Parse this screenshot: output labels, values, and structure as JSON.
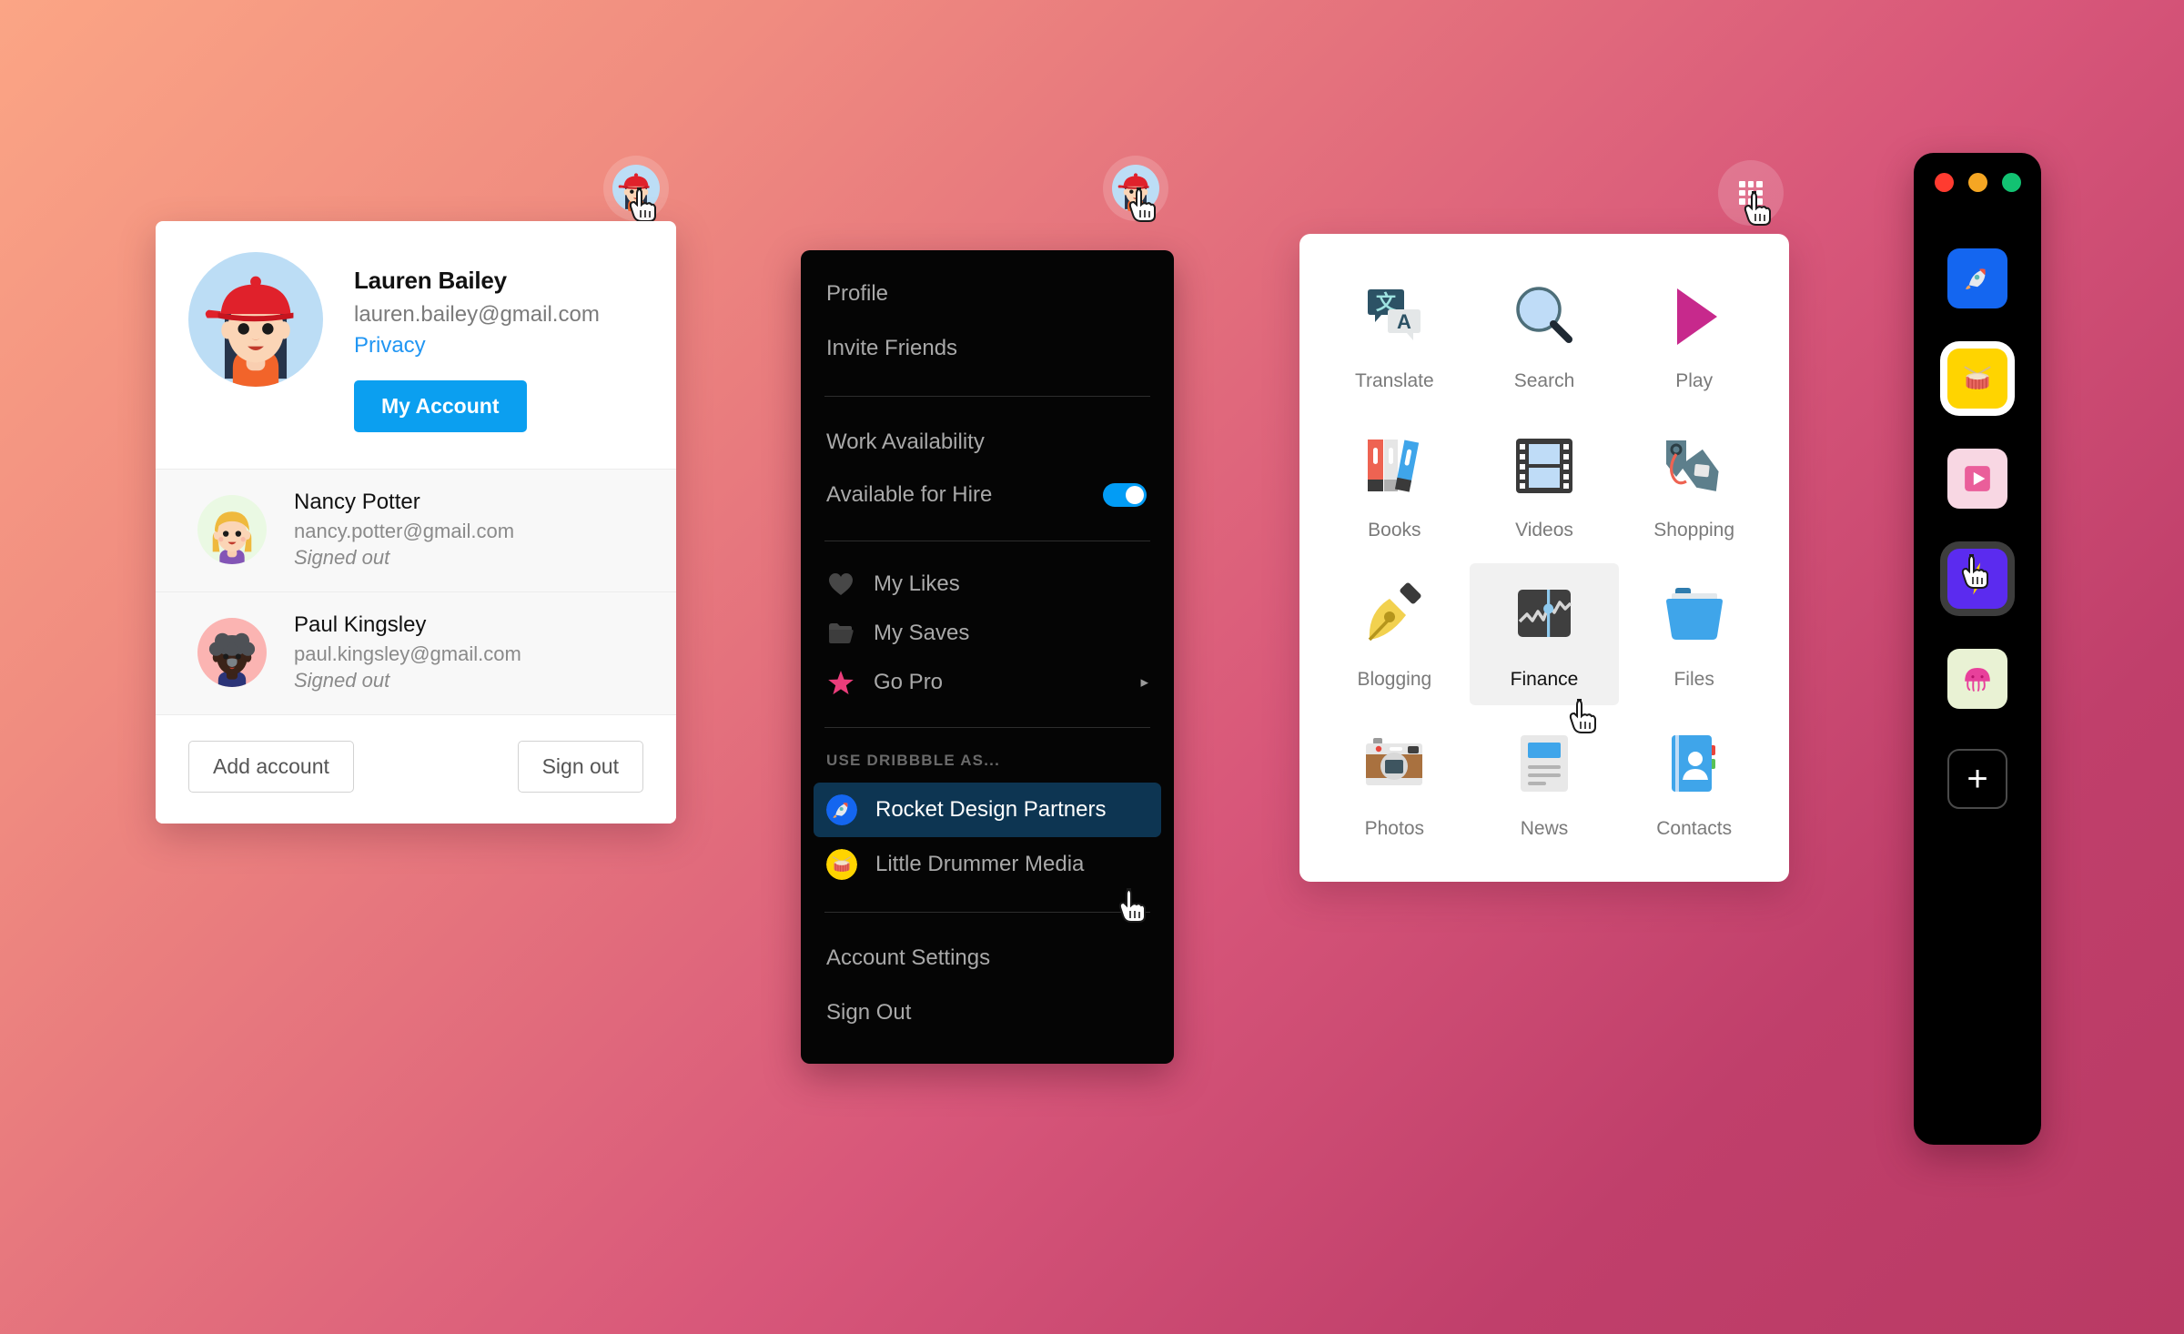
{
  "background": {
    "from": "#FBA585",
    "to": "#B93A64"
  },
  "accent": {
    "blue": "#0b9ff0",
    "link": "#2196f3",
    "pink": "#E83E8C",
    "navy": "#0d3552"
  },
  "triggers": [
    {
      "name": "avatar-trigger-account",
      "icon": "lauren-avatar-icon"
    },
    {
      "name": "avatar-trigger-menu",
      "icon": "lauren-avatar-icon"
    },
    {
      "name": "app-grid-trigger",
      "icon": "grid-dots-icon"
    }
  ],
  "account_card": {
    "primary": {
      "avatar_icon": "lauren-avatar-icon",
      "name": "Lauren Bailey",
      "email": "lauren.bailey@gmail.com",
      "privacy_link": "Privacy",
      "button": "My Account"
    },
    "others": [
      {
        "avatar_icon": "nancy-avatar-icon",
        "name": "Nancy Potter",
        "email": "nancy.potter@gmail.com",
        "status": "Signed out"
      },
      {
        "avatar_icon": "paul-avatar-icon",
        "name": "Paul Kingsley",
        "email": "paul.kingsley@gmail.com",
        "status": "Signed out"
      }
    ],
    "actions": {
      "add": "Add account",
      "signout": "Sign out"
    }
  },
  "dark_menu": {
    "top_items": [
      {
        "label": "Profile",
        "name": "menu-item-profile"
      },
      {
        "label": "Invite Friends",
        "name": "menu-item-invite-friends"
      }
    ],
    "work": {
      "heading": "Work Availability",
      "toggle_label": "Available for Hire",
      "toggle_on": true
    },
    "icon_items": [
      {
        "label": "My Likes",
        "icon": "heart-icon",
        "name": "menu-item-my-likes",
        "caret": false
      },
      {
        "label": "My Saves",
        "icon": "folder-icon",
        "name": "menu-item-my-saves",
        "caret": false
      },
      {
        "label": "Go Pro",
        "icon": "star-icon",
        "name": "menu-item-go-pro",
        "caret": true
      }
    ],
    "section_title": "USE DRIBBBLE AS...",
    "teams": [
      {
        "label": "Rocket Design Partners",
        "icon": "rocket-icon",
        "active": true,
        "name": "team-rocket-design-partners"
      },
      {
        "label": "Little Drummer Media",
        "icon": "drum-icon",
        "active": false,
        "name": "team-little-drummer-media"
      }
    ],
    "bottom_items": [
      {
        "label": "Account Settings",
        "name": "menu-item-account-settings"
      },
      {
        "label": "Sign Out",
        "name": "menu-item-sign-out"
      }
    ]
  },
  "app_grid": {
    "apps": [
      {
        "label": "Translate",
        "icon": "translate-icon",
        "hovered": false
      },
      {
        "label": "Search",
        "icon": "magnifier-icon",
        "hovered": false
      },
      {
        "label": "Play",
        "icon": "play-triangle-icon",
        "hovered": false
      },
      {
        "label": "Books",
        "icon": "books-icon",
        "hovered": false
      },
      {
        "label": "Videos",
        "icon": "film-strip-icon",
        "hovered": false
      },
      {
        "label": "Shopping",
        "icon": "price-tag-icon",
        "hovered": false
      },
      {
        "label": "Blogging",
        "icon": "fountain-pen-icon",
        "hovered": false
      },
      {
        "label": "Finance",
        "icon": "stock-chart-icon",
        "hovered": true
      },
      {
        "label": "Files",
        "icon": "folder-blue-icon",
        "hovered": false
      },
      {
        "label": "Photos",
        "icon": "camera-icon",
        "hovered": false
      },
      {
        "label": "News",
        "icon": "newspaper-icon",
        "hovered": false
      },
      {
        "label": "Contacts",
        "icon": "address-book-icon",
        "hovered": false
      }
    ]
  },
  "dock": {
    "window_lights": [
      "#FF3B30",
      "#F5A623",
      "#12C272"
    ],
    "items": [
      {
        "icon": "rocket-icon",
        "tile_color": "#1466F0",
        "selected": "none",
        "name": "dock-item-rocket"
      },
      {
        "icon": "drum-icon",
        "tile_color": "#FFD400",
        "selected": "white",
        "name": "dock-item-drum"
      },
      {
        "icon": "play-square-icon",
        "tile_color": "#F8D7E3",
        "selected": "none",
        "name": "dock-item-play"
      },
      {
        "icon": "lightning-icon",
        "tile_color": "#5B2BEF",
        "selected": "gray",
        "name": "dock-item-lightning"
      },
      {
        "icon": "jellyfish-icon",
        "tile_color": "#E9F2D4",
        "selected": "none",
        "name": "dock-item-jellyfish"
      }
    ],
    "add_label": "+"
  }
}
